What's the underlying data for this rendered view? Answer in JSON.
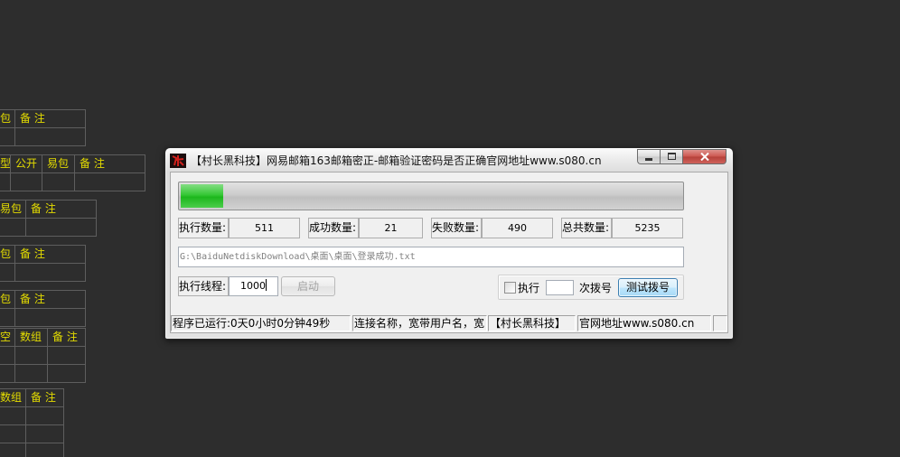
{
  "desktop": {
    "background_color": "#2d2d2d",
    "grid_text_color": "#e4dc00",
    "tables": [
      {
        "headers": [
          "包",
          "备 注"
        ],
        "rows": [
          [
            "",
            ""
          ]
        ]
      },
      {
        "headers": [
          "型",
          "公开",
          "易包",
          "备 注"
        ],
        "rows": [
          [
            "",
            "",
            "",
            ""
          ]
        ]
      },
      {
        "headers": [
          "易包",
          "备 注"
        ],
        "rows": [
          [
            "",
            ""
          ]
        ]
      },
      {
        "headers": [
          "包",
          "备 注"
        ],
        "rows": [
          [
            "",
            ""
          ]
        ]
      },
      {
        "headers": [
          "包",
          "备 注"
        ],
        "rows": [
          [
            "",
            ""
          ]
        ]
      },
      {
        "headers": [
          "空",
          "数组",
          "备 注"
        ],
        "rows": [
          [
            "",
            "",
            ""
          ],
          [
            "",
            "",
            ""
          ]
        ]
      },
      {
        "headers": [
          "数组",
          "备 注"
        ],
        "rows": [
          [
            "",
            ""
          ],
          [
            "",
            ""
          ],
          [
            "",
            ""
          ]
        ]
      }
    ]
  },
  "window": {
    "title": "【村长黑科技】网易邮箱163邮箱密正-邮箱验证密码是否正确官网地址www.s080.cn",
    "icon": "app-logo-icon",
    "controls": [
      "minimize-icon",
      "maximize-icon",
      "close-icon"
    ],
    "close_color": "#c8473f",
    "progress": 0.085,
    "progress_color": "#1fc21f",
    "stats": [
      {
        "label": "执行数量:",
        "value": "511"
      },
      {
        "label": "成功数量:",
        "value": "21"
      },
      {
        "label": "失败数量:",
        "value": "490"
      },
      {
        "label": "总共数量:",
        "value": "5235"
      }
    ],
    "file_path": "G:\\BaiduNetdiskDownload\\桌面\\桌面\\登录成功.txt",
    "threads": {
      "label": "执行线程:",
      "value": "1000"
    },
    "start_button": {
      "label": "启动",
      "enabled": false
    },
    "dial": {
      "checkbox_label": "执行",
      "checked": false,
      "count_value": "",
      "suffix_label": "次拨号",
      "test_button": "测试拨号"
    },
    "status_bar": {
      "runtime": "程序已运行:0天0小时0分钟49秒",
      "connection": "连接名称，宽带用户名，宽",
      "brand": "【村长黑科技】",
      "website": "官网地址www.s080.cn"
    }
  }
}
